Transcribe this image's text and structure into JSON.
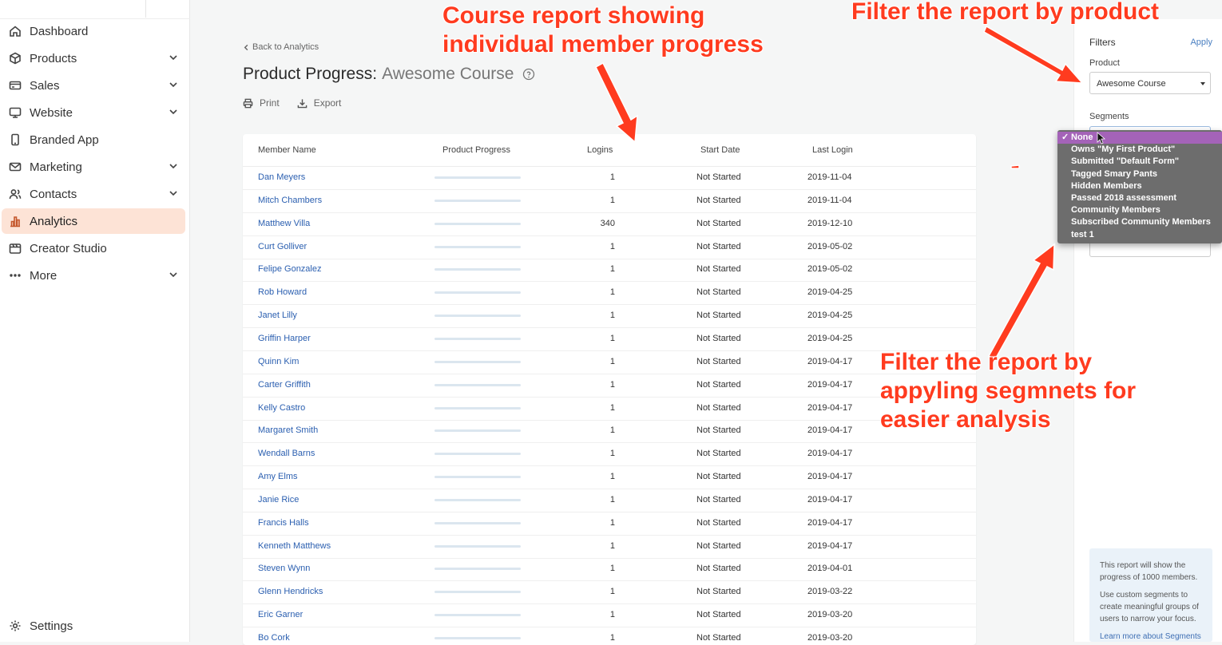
{
  "sidebar": {
    "items": [
      {
        "label": "Dashboard",
        "icon": "home-icon",
        "has_chevron": false,
        "active": false
      },
      {
        "label": "Products",
        "icon": "cube-icon",
        "has_chevron": true,
        "active": false
      },
      {
        "label": "Sales",
        "icon": "credit-card-icon",
        "has_chevron": true,
        "active": false
      },
      {
        "label": "Website",
        "icon": "monitor-icon",
        "has_chevron": true,
        "active": false
      },
      {
        "label": "Branded App",
        "icon": "phone-icon",
        "has_chevron": false,
        "active": false
      },
      {
        "label": "Marketing",
        "icon": "mail-icon",
        "has_chevron": true,
        "active": false
      },
      {
        "label": "Contacts",
        "icon": "users-icon",
        "has_chevron": true,
        "active": false
      },
      {
        "label": "Analytics",
        "icon": "bar-chart-icon",
        "has_chevron": false,
        "active": true
      },
      {
        "label": "Creator Studio",
        "icon": "studio-icon",
        "has_chevron": false,
        "active": false
      },
      {
        "label": "More",
        "icon": "dots-icon",
        "has_chevron": true,
        "active": false
      }
    ],
    "settings_label": "Settings",
    "accent_color": "#fde3d6"
  },
  "main": {
    "back_label": "Back to Analytics",
    "title_prefix": "Product Progress:",
    "title_product": "Awesome Course",
    "print_label": "Print",
    "export_label": "Export"
  },
  "table": {
    "headers": {
      "member": "Member Name",
      "progress": "Product Progress",
      "logins": "Logins",
      "start": "Start Date",
      "last": "Last Login"
    },
    "rows": [
      {
        "name": "Dan Meyers",
        "progress": 0,
        "logins": "1",
        "start": "Not Started",
        "last": "2019-11-04"
      },
      {
        "name": "Mitch Chambers",
        "progress": 0,
        "logins": "1",
        "start": "Not Started",
        "last": "2019-11-04"
      },
      {
        "name": "Matthew Villa",
        "progress": 0,
        "logins": "340",
        "start": "Not Started",
        "last": "2019-12-10"
      },
      {
        "name": "Curt Golliver",
        "progress": 0,
        "logins": "1",
        "start": "Not Started",
        "last": "2019-05-02"
      },
      {
        "name": "Felipe Gonzalez",
        "progress": 0,
        "logins": "1",
        "start": "Not Started",
        "last": "2019-05-02"
      },
      {
        "name": "Rob Howard",
        "progress": 0,
        "logins": "1",
        "start": "Not Started",
        "last": "2019-04-25"
      },
      {
        "name": "Janet Lilly",
        "progress": 0,
        "logins": "1",
        "start": "Not Started",
        "last": "2019-04-25"
      },
      {
        "name": "Griffin Harper",
        "progress": 0,
        "logins": "1",
        "start": "Not Started",
        "last": "2019-04-25"
      },
      {
        "name": "Quinn Kim",
        "progress": 0,
        "logins": "1",
        "start": "Not Started",
        "last": "2019-04-17"
      },
      {
        "name": "Carter Griffith",
        "progress": 0,
        "logins": "1",
        "start": "Not Started",
        "last": "2019-04-17"
      },
      {
        "name": "Kelly Castro",
        "progress": 0,
        "logins": "1",
        "start": "Not Started",
        "last": "2019-04-17"
      },
      {
        "name": "Margaret Smith",
        "progress": 0,
        "logins": "1",
        "start": "Not Started",
        "last": "2019-04-17"
      },
      {
        "name": "Wendall Barns",
        "progress": 0,
        "logins": "1",
        "start": "Not Started",
        "last": "2019-04-17"
      },
      {
        "name": "Amy Elms",
        "progress": 0,
        "logins": "1",
        "start": "Not Started",
        "last": "2019-04-17"
      },
      {
        "name": "Janie Rice",
        "progress": 0,
        "logins": "1",
        "start": "Not Started",
        "last": "2019-04-17"
      },
      {
        "name": "Francis Halls",
        "progress": 0,
        "logins": "1",
        "start": "Not Started",
        "last": "2019-04-17"
      },
      {
        "name": "Kenneth Matthews",
        "progress": 0,
        "logins": "1",
        "start": "Not Started",
        "last": "2019-04-17"
      },
      {
        "name": "Steven Wynn",
        "progress": 0,
        "logins": "1",
        "start": "Not Started",
        "last": "2019-04-01"
      },
      {
        "name": "Glenn Hendricks",
        "progress": 0,
        "logins": "1",
        "start": "Not Started",
        "last": "2019-03-22"
      },
      {
        "name": "Eric Garner",
        "progress": 0,
        "logins": "1",
        "start": "Not Started",
        "last": "2019-03-20"
      },
      {
        "name": "Bo Cork",
        "progress": 0,
        "logins": "1",
        "start": "Not Started",
        "last": "2019-03-20"
      }
    ]
  },
  "filters": {
    "title": "Filters",
    "apply_label": "Apply",
    "product_label": "Product",
    "product_value": "Awesome Course",
    "segments_label": "Segments",
    "segment_options": [
      "None",
      "Owns \"My First Product\"",
      "Submitted \"Default Form\"",
      "Tagged Smary Pants",
      "Hidden Members",
      "Passed 2018 assessment",
      "Community Members",
      "Subscribed Community Members",
      "test 1"
    ],
    "selected_segment": "None",
    "info_p1": "This report will show the progress of 1000 members.",
    "info_p2": "Use custom segments to create meaningful groups of users to narrow your focus.",
    "info_link": "Learn more about Segments"
  },
  "annotations": {
    "course_line1": "Course report showing",
    "course_line2": "individual member progress",
    "product_filter": "Filter the report by product",
    "segment_line1": "Filter the report by",
    "segment_line2": "appyling segmnets for",
    "segment_line3": "easier analysis",
    "color": "#ff3b1f"
  }
}
